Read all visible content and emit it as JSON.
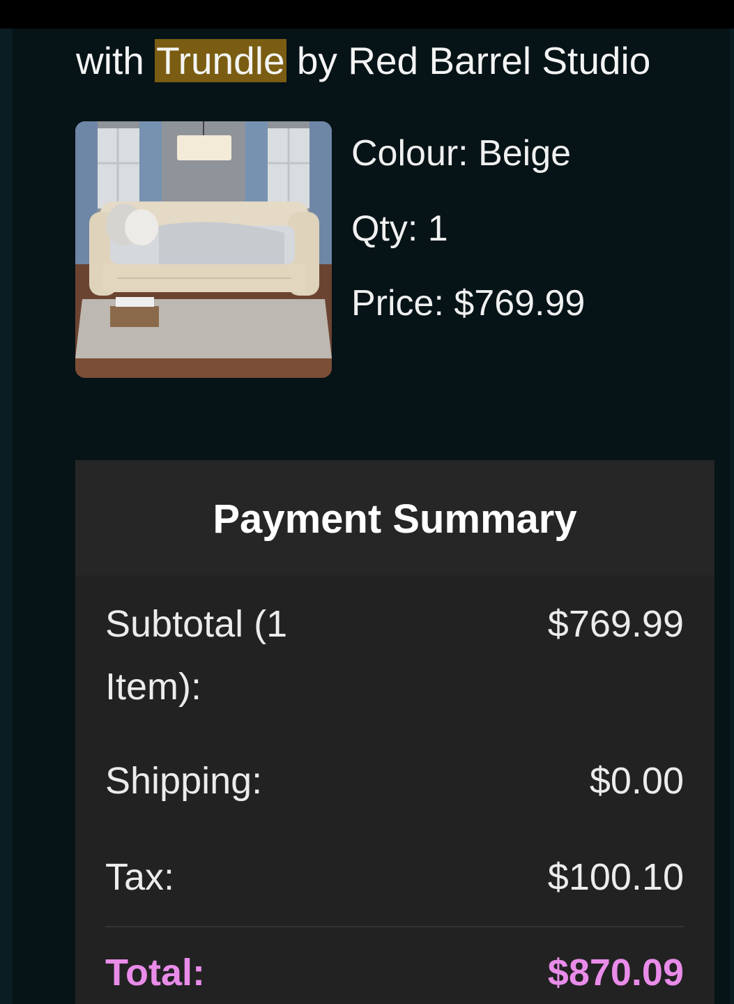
{
  "product": {
    "title_prefix": "with ",
    "title_highlight": "Trundle",
    "title_suffix": " by Red Barrel Studio",
    "colour": "Colour: Beige",
    "qty": "Qty: 1",
    "price": "Price: $769.99"
  },
  "summary": {
    "title": "Payment Summary",
    "subtotal_label": "Subtotal (1 Item):",
    "subtotal_value": "$769.99",
    "shipping_label": "Shipping:",
    "shipping_value": "$0.00",
    "tax_label": "Tax:",
    "tax_value": "$100.10",
    "total_label": "Total:",
    "total_value": "$870.09"
  },
  "colors": {
    "background": "#061317",
    "panel": "#222222",
    "highlight": "#7a5d12",
    "total_accent": "#e98ce9"
  }
}
